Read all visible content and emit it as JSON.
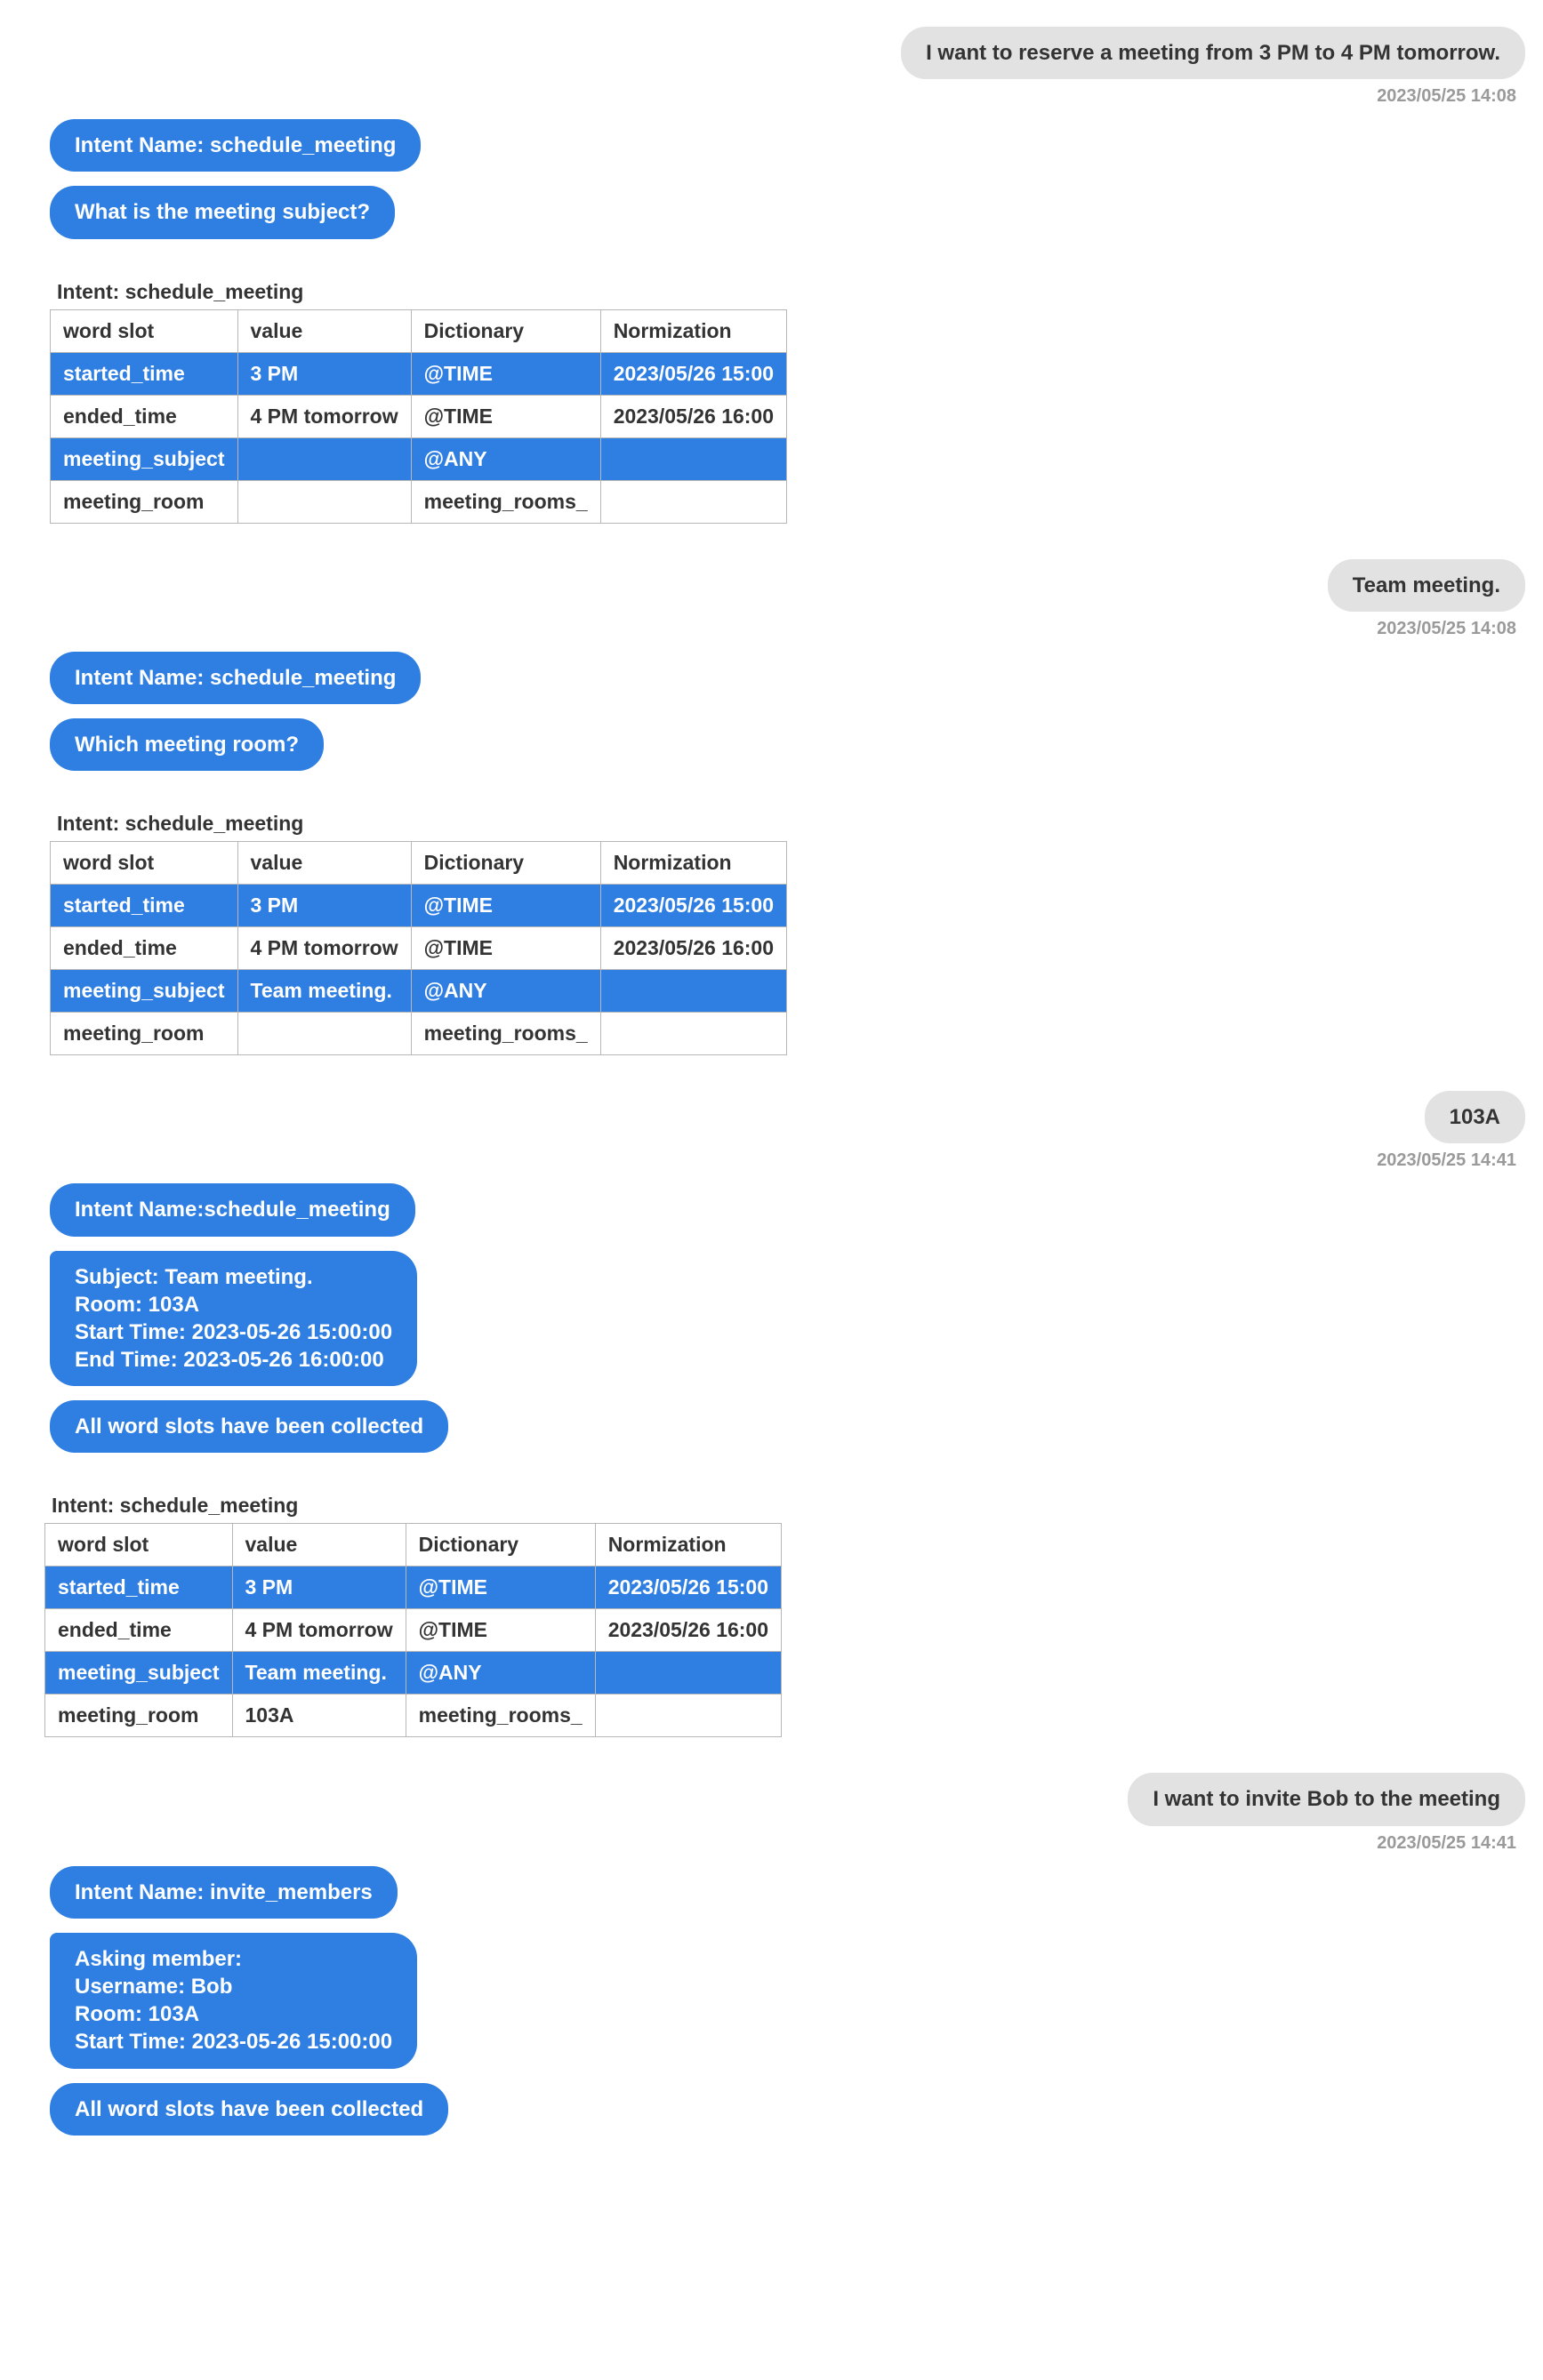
{
  "table_headers": {
    "word_slot": "word slot",
    "value": "value",
    "dictionary": "Dictionary",
    "normization": "Normization"
  },
  "exchanges": [
    {
      "user": {
        "text": "I want to reserve a meeting from 3 PM to 4 PM tomorrow.",
        "ts": "2023/05/25 14:08"
      },
      "bot_bubbles": [
        "Intent Name: schedule_meeting",
        "What is the meeting subject?"
      ],
      "intent_label": "Intent: schedule_meeting",
      "rows": [
        {
          "hl": true,
          "slot": "started_time",
          "value": "3 PM",
          "dict": "@TIME",
          "norm": "2023/05/26 15:00"
        },
        {
          "hl": false,
          "slot": "ended_time",
          "value": "4 PM tomorrow",
          "dict": "@TIME",
          "norm": "2023/05/26 16:00"
        },
        {
          "hl": true,
          "slot": "meeting_subject",
          "value": "",
          "dict": "@ANY",
          "norm": ""
        },
        {
          "hl": false,
          "slot": "meeting_room",
          "value": "",
          "dict": "meeting_rooms_",
          "norm": ""
        }
      ]
    },
    {
      "user": {
        "text": "Team meeting.",
        "ts": "2023/05/25 14:08"
      },
      "bot_bubbles": [
        "Intent Name: schedule_meeting",
        "Which meeting room?"
      ],
      "intent_label": "Intent: schedule_meeting",
      "rows": [
        {
          "hl": true,
          "slot": "started_time",
          "value": "3 PM",
          "dict": "@TIME",
          "norm": "2023/05/26 15:00"
        },
        {
          "hl": false,
          "slot": "ended_time",
          "value": "4 PM tomorrow",
          "dict": "@TIME",
          "norm": "2023/05/26 16:00"
        },
        {
          "hl": true,
          "slot": "meeting_subject",
          "value": "Team meeting.",
          "dict": "@ANY",
          "norm": ""
        },
        {
          "hl": false,
          "slot": "meeting_room",
          "value": "",
          "dict": "meeting_rooms_",
          "norm": ""
        }
      ]
    },
    {
      "user": {
        "text": "103A",
        "ts": "2023/05/25 14:41"
      },
      "bot_bubbles": [
        "Intent Name:schedule_meeting",
        " Subject: Team meeting.\nRoom: 103A\nStart Time: 2023-05-26 15:00:00\nEnd Time: 2023-05-26 16:00:00",
        "All word slots have been collected"
      ],
      "intent_label": "Intent: schedule_meeting",
      "rows": [
        {
          "hl": true,
          "slot": "started_time",
          "value": "3 PM",
          "dict": "@TIME",
          "norm": "2023/05/26 15:00"
        },
        {
          "hl": false,
          "slot": "ended_time",
          "value": "4 PM tomorrow",
          "dict": "@TIME",
          "norm": "2023/05/26 16:00"
        },
        {
          "hl": true,
          "slot": "meeting_subject",
          "value": "Team meeting.",
          "dict": "@ANY",
          "norm": ""
        },
        {
          "hl": false,
          "slot": "meeting_room",
          "value": "103A",
          "dict": "meeting_rooms_",
          "norm": ""
        }
      ]
    },
    {
      "user": {
        "text": "I want to invite Bob to the meeting",
        "ts": "2023/05/25 14:41"
      },
      "bot_bubbles": [
        "Intent Name: invite_members",
        "Asking member:\nUsername: Bob\nRoom: 103A\nStart Time: 2023-05-26 15:00:00",
        "All word slots have been collected"
      ],
      "intent_label": null,
      "rows": []
    }
  ]
}
